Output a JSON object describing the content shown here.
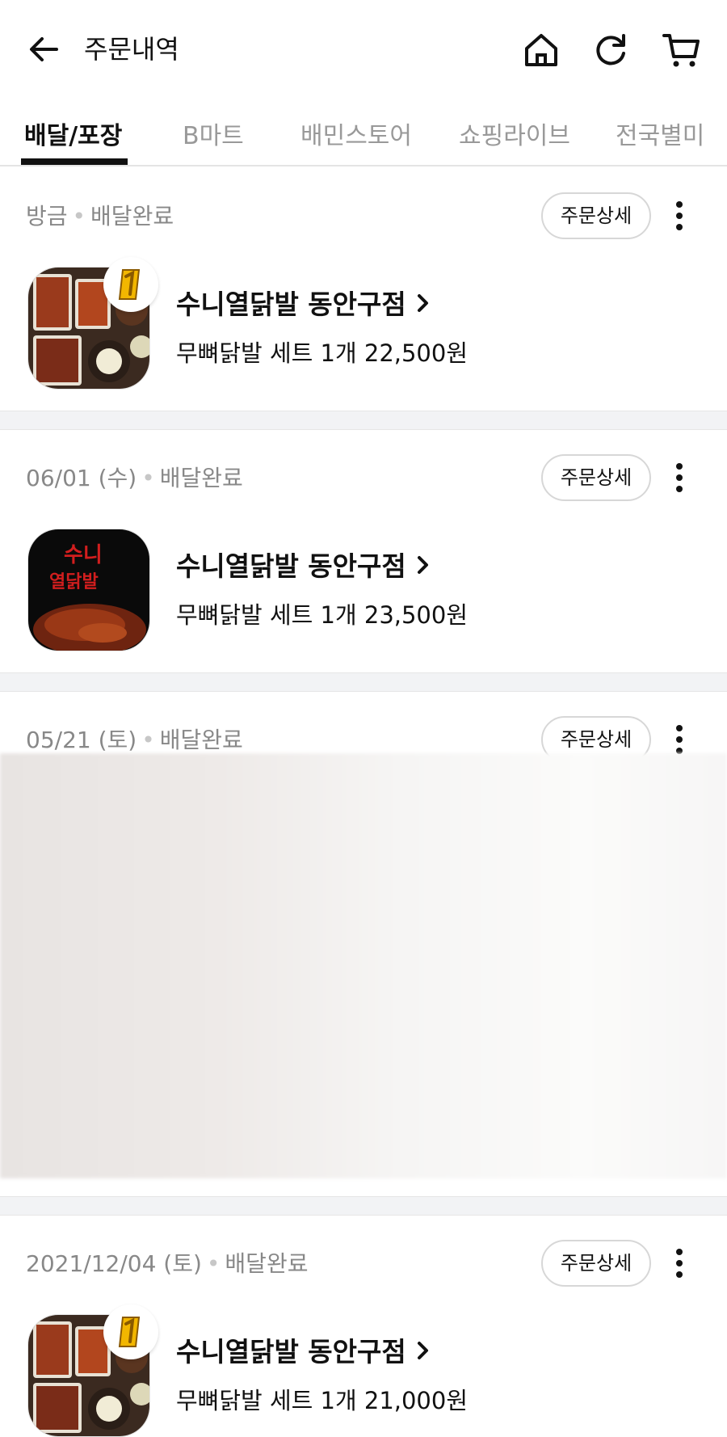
{
  "header": {
    "title": "주문내역",
    "icons": [
      "back-arrow-icon",
      "home-icon",
      "refresh-icon",
      "cart-icon"
    ]
  },
  "tabs": [
    {
      "label": "배달/포장",
      "active": true
    },
    {
      "label": "B마트",
      "active": false
    },
    {
      "label": "배민스토어",
      "active": false
    },
    {
      "label": "쇼핑라이브",
      "active": false
    },
    {
      "label": "전국별미",
      "active": false
    }
  ],
  "orders": [
    {
      "date": "방금",
      "status": "배달완료",
      "detail_label": "주문상세",
      "store": "수니열닭발 동안구점",
      "summary": "무뼈닭발 세트 1개 22,500원",
      "thumb": "food-platter",
      "badge": "1"
    },
    {
      "date": "06/01 (수)",
      "status": "배달완료",
      "detail_label": "주문상세",
      "store": "수니열닭발 동안구점",
      "summary": "무뼈닭발 세트 1개 23,500원",
      "thumb": "logo",
      "logo_text": [
        "수니",
        "열닭발"
      ]
    },
    {
      "date": "05/21 (토)",
      "status": "배달완료",
      "detail_label": "주문상세"
    },
    {
      "date": "2021/12/04 (토)",
      "status": "배달완료",
      "detail_label": "주문상세",
      "store": "수니열닭발 동안구점",
      "summary": "무뼈닭발 세트 1개 21,000원",
      "thumb": "food-platter",
      "badge": "1"
    }
  ],
  "colors": {
    "text": "#111111",
    "muted": "#888888",
    "separator": "#f2f3f5",
    "badge_gold": "#f2b600"
  }
}
